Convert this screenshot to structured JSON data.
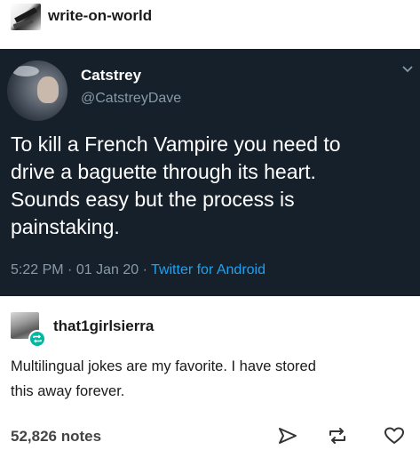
{
  "post": {
    "username": "write-on-world",
    "avatar_icon": "avatar-icon"
  },
  "tweet": {
    "display_name": "Catstrey",
    "handle": "@CatstreyDave",
    "text_lines": [
      "To kill a French Vampire you need to",
      "drive a baguette through its heart.",
      "Sounds easy but the process is",
      "painstaking."
    ],
    "time": "5:22 PM",
    "date": "01 Jan 20",
    "separator": "·",
    "source": "Twitter for Android",
    "menu_icon": "chevron-down-icon",
    "colors": {
      "background": "#15202b",
      "text": "#ffffff",
      "muted": "#8899a6",
      "link": "#1da1f2"
    }
  },
  "reblog": {
    "username": "that1girlsierra",
    "badge_icon": "reblog-badge-icon",
    "comment_lines": [
      "Multilingual jokes are my favorite. I have stored",
      "this away forever."
    ]
  },
  "footer": {
    "notes": "52,826 notes",
    "icons": [
      "share-icon",
      "reblog-icon",
      "heart-icon"
    ]
  }
}
